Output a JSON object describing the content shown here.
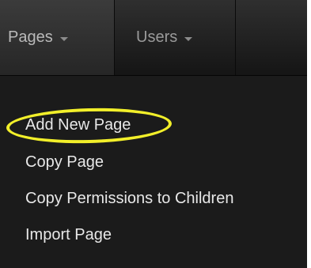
{
  "navbar": {
    "pages_label": "Pages",
    "users_label": "Users"
  },
  "dropdown": {
    "items": [
      {
        "label": "Add New Page",
        "highlighted": true
      },
      {
        "label": "Copy Page"
      },
      {
        "label": "Copy Permissions to Children"
      },
      {
        "label": "Import Page"
      }
    ]
  },
  "colors": {
    "navbar_bg": "#1f1f1f",
    "dropdown_bg": "#1b1b1b",
    "highlight": "#f2ef2a"
  }
}
